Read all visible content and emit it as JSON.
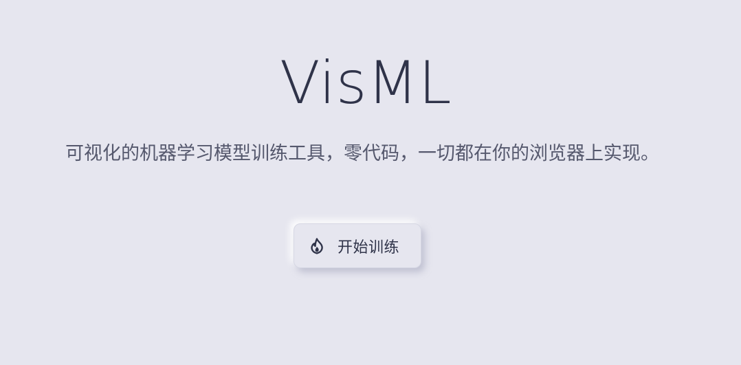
{
  "hero": {
    "title": "VisML",
    "subtitle": "可视化的机器学习模型训练工具，零代码，一切都在你的浏览器上实现。",
    "start_button": {
      "label": "开始训练",
      "icon": "flame-icon"
    }
  },
  "colors": {
    "background": "#e6e6ef",
    "title": "#2f3349",
    "subtitle": "#55586d"
  }
}
